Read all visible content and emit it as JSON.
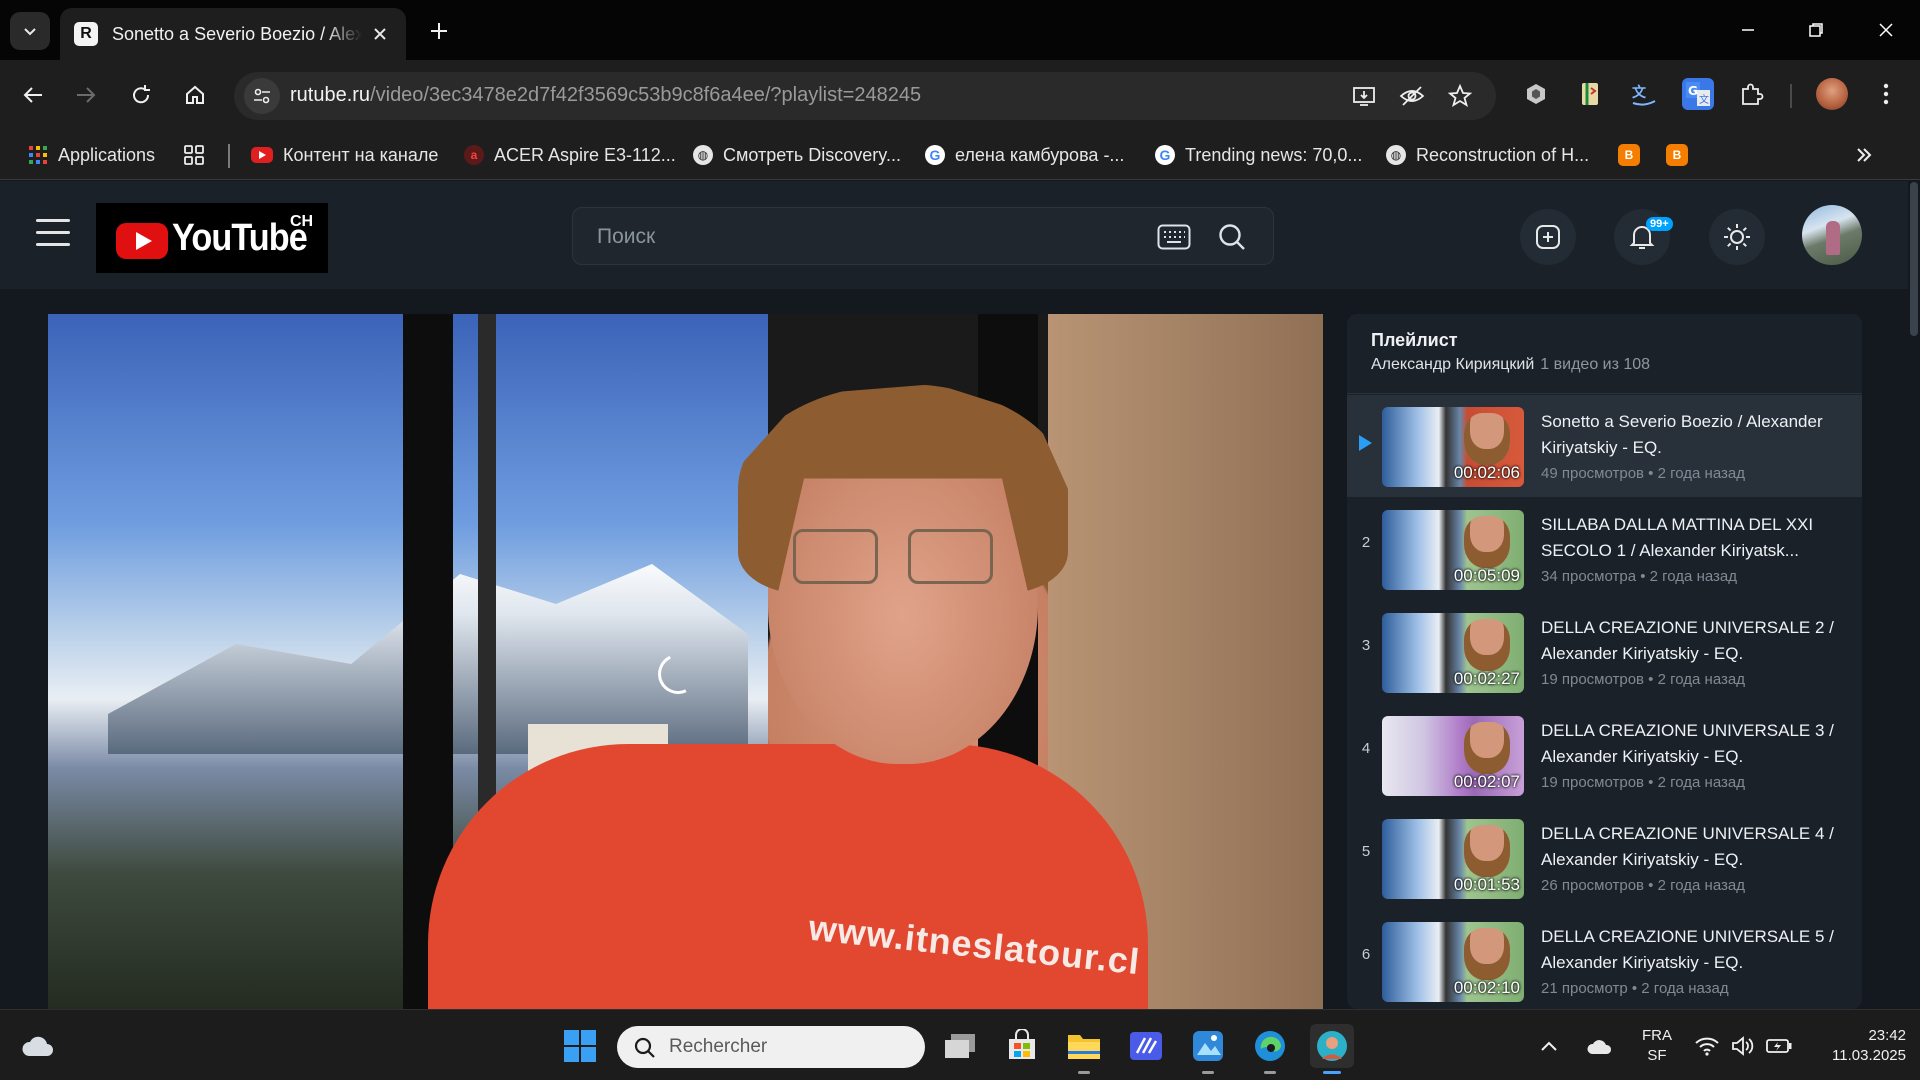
{
  "browser": {
    "tab_title": "Sonetto a Severio Boezio / Alexander Kiriyatskiy - EQ.",
    "tab_favicon_letter": "R",
    "url_host": "rutube.ru",
    "url_path": "/video/3ec3478e2d7f42f3569c53b9c8f6a4ee/?playlist=248245",
    "bookmarks": [
      {
        "label": "Applications",
        "icon": "apps-grid-icon"
      },
      {
        "label": "",
        "icon": "tab-groups-icon"
      },
      {
        "label": "Контент на канале",
        "icon": "youtube-icon"
      },
      {
        "label": "ACER Aspire E3-112...",
        "icon": "acer-icon"
      },
      {
        "label": "Смотреть Discovery...",
        "icon": "globe-icon"
      },
      {
        "label": "елена камбурова -...",
        "icon": "google-icon"
      },
      {
        "label": "Trending news: 70,0...",
        "icon": "google-icon"
      },
      {
        "label": "Reconstruction of H...",
        "icon": "globe-icon"
      }
    ]
  },
  "rutube": {
    "logo_word": "YouTube",
    "logo_suffix": "CH",
    "search_placeholder": "Поиск",
    "notification_badge": "99+"
  },
  "video": {
    "shirt_text": "www.itneslatour.cl"
  },
  "playlist": {
    "title": "Плейлист",
    "author": "Александр Кирияцкий",
    "count": "1 видео из 108",
    "items": [
      {
        "num": "",
        "title": "Sonetto a Severio Boezio / Alexander Kiriyatskiy - EQ.",
        "duration": "00:02:06",
        "views": "49 просмотров",
        "age": "2 года назад"
      },
      {
        "num": "2",
        "title": "SILLABA DALLA MATTINA DEL XXI SECOLO 1 / Alexander Kiriyatsk...",
        "duration": "00:05:09",
        "views": "34 просмотра",
        "age": "2 года назад"
      },
      {
        "num": "3",
        "title": "DELLA CREAZIONE UNIVERSALE 2 / Alexander Kiriyatskiy - EQ.",
        "duration": "00:02:27",
        "views": "19 просмотров",
        "age": "2 года назад"
      },
      {
        "num": "4",
        "title": "DELLA CREAZIONE UNIVERSALE 3 / Alexander Kiriyatskiy - EQ.",
        "duration": "00:02:07",
        "views": "19 просмотров",
        "age": "2 года назад"
      },
      {
        "num": "5",
        "title": "DELLA CREAZIONE UNIVERSALE 4 / Alexander Kiriyatskiy - EQ.",
        "duration": "00:01:53",
        "views": "26 просмотров",
        "age": "2 года назад"
      },
      {
        "num": "6",
        "title": "DELLA CREAZIONE UNIVERSALE 5 / Alexander Kiriyatskiy - EQ.",
        "duration": "00:02:10",
        "views": "21 просмотр",
        "age": "2 года назад"
      }
    ]
  },
  "taskbar": {
    "search_placeholder": "Rechercher",
    "lang_line1": "FRA",
    "lang_line2": "SF",
    "time": "23:42",
    "date": "11.03.2025"
  },
  "colors": {
    "accent_blue": "#2a9df4",
    "badge_blue": "#00a2ff",
    "page_bg": "#14191f",
    "header_bg": "#1b2128"
  }
}
